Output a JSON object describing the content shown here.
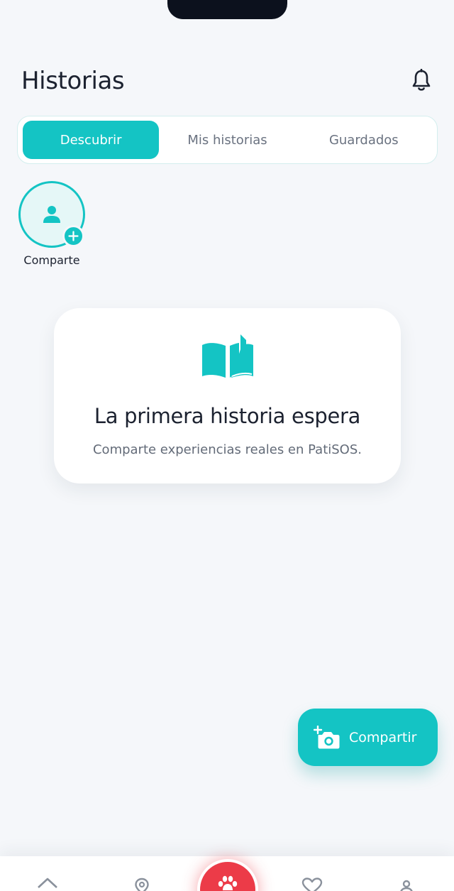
{
  "header": {
    "title": "Historias",
    "notification_icon": "bell-icon"
  },
  "tabs": [
    {
      "label": "Descubrir",
      "active": true
    },
    {
      "label": "Mis historias",
      "active": false
    },
    {
      "label": "Guardados",
      "active": false
    }
  ],
  "story_add": {
    "label": "Comparte",
    "icon": "user-icon",
    "badge_icon": "plus-icon"
  },
  "empty_state": {
    "icon": "open-book-icon",
    "title": "La primera historia espera",
    "subtitle": "Comparte experiencias reales en PatiSOS."
  },
  "fab": {
    "label": "Compartir",
    "icon": "add-photo-icon"
  },
  "bottom_nav": {
    "items": [
      {
        "icon": "home-icon"
      },
      {
        "icon": "map-pin-icon"
      },
      {
        "icon": "paw-icon",
        "center": true
      },
      {
        "icon": "heart-icon"
      },
      {
        "icon": "profile-icon"
      }
    ]
  },
  "colors": {
    "accent": "#14c4c4",
    "background": "#f5f7fa",
    "sos_red": "#ec3b48",
    "text_primary": "#1c2230",
    "text_secondary": "#636b78"
  }
}
